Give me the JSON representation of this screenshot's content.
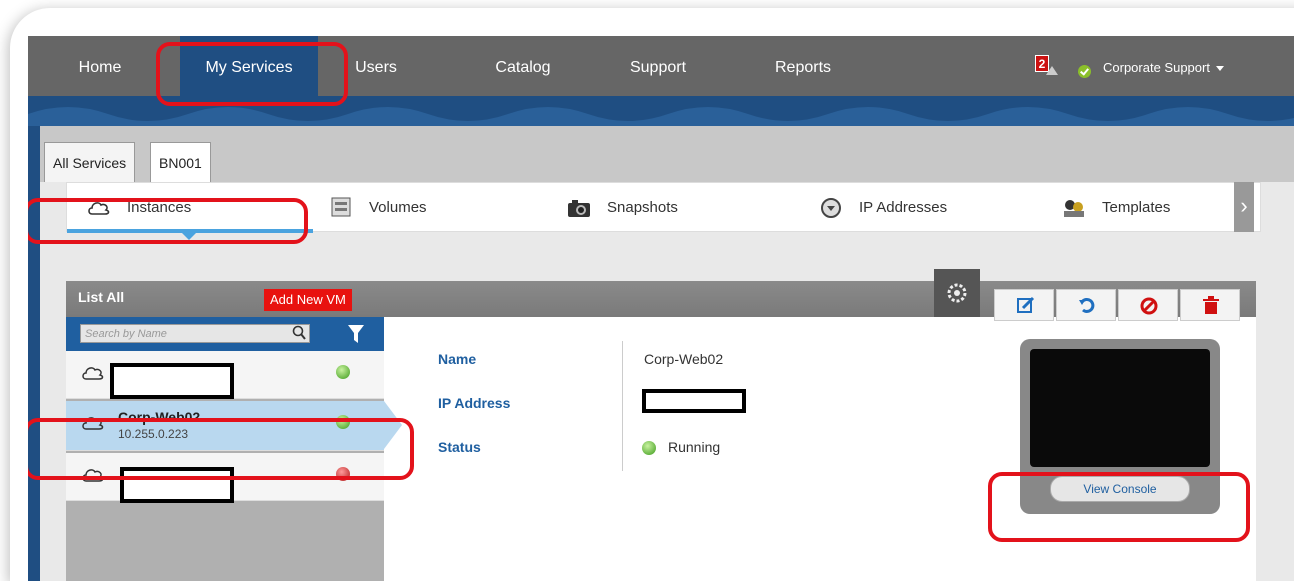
{
  "nav": {
    "items": [
      "Home",
      "My Services",
      "Users",
      "Catalog",
      "Support",
      "Reports"
    ],
    "notification_count": "2",
    "user_label": "Corporate Support"
  },
  "service_tabs": [
    "All Services",
    "BN001"
  ],
  "subnav": [
    "Instances",
    "Volumes",
    "Snapshots",
    "IP Addresses",
    "Templates"
  ],
  "list": {
    "title": "List All",
    "add_label": "Add New VM",
    "search_placeholder": "Search by Name",
    "rows": [
      {
        "name": "",
        "ip": "",
        "status": "green"
      },
      {
        "name": "Corp-Web02",
        "ip": "10.255.0.223",
        "status": "green"
      },
      {
        "name": "",
        "ip": "",
        "status": "red"
      }
    ]
  },
  "details": {
    "name_label": "Name",
    "ip_label": "IP Address",
    "status_label": "Status",
    "name_value": "Corp-Web02",
    "status_value": "Running"
  },
  "console": {
    "button_label": "View Console"
  },
  "colors": {
    "accent_blue": "#1f4e82",
    "highlight_red": "#e3121b",
    "add_red": "#e8120f"
  }
}
